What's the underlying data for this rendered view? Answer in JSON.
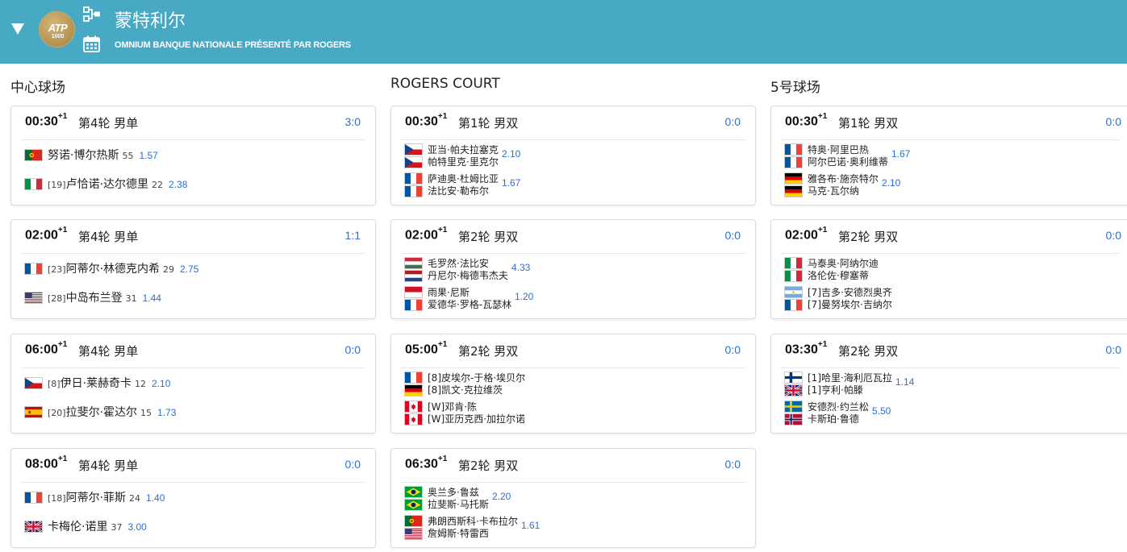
{
  "header": {
    "tournament_name": "蒙特利尔",
    "tournament_subtitle": "OMNIUM BANQUE NATIONALE PRÉSENTÉ PAR ROGERS",
    "logo_text": "ATP",
    "logo_sub": "1000",
    "bracket_icon": "bracket-icon",
    "calendar_icon": "calendar-icon",
    "collapse_icon": "triangle-down-icon",
    "bg_color": "#48a9c5"
  },
  "colors": {
    "accent": "#2a6fd6"
  },
  "courts": [
    {
      "title": "中心球场",
      "matches": [
        {
          "time": "00:30",
          "day": "+1",
          "round": "第4轮 男单",
          "score": "3:0",
          "p1": {
            "flag": "por",
            "seed": "",
            "name": "努诺·博尔热斯",
            "rank": "55",
            "odds": "1.57"
          },
          "p2": {
            "flag": "ita",
            "seed": "[19]",
            "name": "卢恰诺·达尔德里",
            "rank": "22",
            "odds": "2.38"
          }
        },
        {
          "time": "02:00",
          "day": "+1",
          "round": "第4轮 男单",
          "score": "1:1",
          "p1": {
            "flag": "fra",
            "seed": "[23]",
            "name": "阿蒂尔·林德克内希",
            "rank": "29",
            "odds": "2.75"
          },
          "p2": {
            "flag": "usa",
            "seed": "[28]",
            "name": "中岛布兰登",
            "rank": "31",
            "odds": "1.44"
          }
        },
        {
          "time": "06:00",
          "day": "+1",
          "round": "第4轮 男单",
          "score": "0:0",
          "p1": {
            "flag": "cze",
            "seed": "[8]",
            "name": "伊日·莱赫奇卡",
            "rank": "12",
            "odds": "2.10"
          },
          "p2": {
            "flag": "esp",
            "seed": "[20]",
            "name": "拉斐尔·霍达尔",
            "rank": "15",
            "odds": "1.73"
          }
        },
        {
          "time": "08:00",
          "day": "+1",
          "round": "第4轮 男单",
          "score": "0:0",
          "p1": {
            "flag": "fra",
            "seed": "[18]",
            "name": "阿蒂尔·菲斯",
            "rank": "24",
            "odds": "1.40"
          },
          "p2": {
            "flag": "gbr",
            "seed": "",
            "name": "卡梅伦·诺里",
            "rank": "37",
            "odds": "3.00"
          }
        }
      ]
    },
    {
      "title": "ROGERS COURT",
      "matches": [
        {
          "time": "00:30",
          "day": "+1",
          "round": "第1轮 男双",
          "score": "0:0",
          "t1": {
            "flags": [
              "cze",
              "cze"
            ],
            "names": [
              "亚当·帕夫拉塞克",
              "帕特里克·里克尔"
            ],
            "odds": "2.10"
          },
          "t2": {
            "flags": [
              "fra",
              "fra"
            ],
            "names": [
              "萨迪奥·杜姆比亚",
              "法比安·勒布尔"
            ],
            "odds": "1.67"
          }
        },
        {
          "time": "02:00",
          "day": "+1",
          "round": "第2轮 男双",
          "score": "0:0",
          "t1": {
            "flags": [
              "hun",
              "ned"
            ],
            "names": [
              "毛罗然·法比安",
              "丹尼尔·梅德韦杰夫"
            ],
            "odds": "4.33"
          },
          "t2": {
            "flags": [
              "mon",
              "fra"
            ],
            "names": [
              "雨果·尼斯",
              "爱德华·罗格-瓦瑟林"
            ],
            "odds": "1.20"
          }
        },
        {
          "time": "05:00",
          "day": "+1",
          "round": "第2轮 男双",
          "score": "0:0",
          "t1": {
            "flags": [
              "fra",
              "ger"
            ],
            "names": [
              "[8]皮埃尔-于格·埃贝尔",
              "[8]凯文·克拉维茨"
            ],
            "odds": ""
          },
          "t2": {
            "flags": [
              "can",
              "can"
            ],
            "names": [
              "[W]邓肯·陈",
              "[W]亚历克西·加拉尔诺"
            ],
            "odds": ""
          }
        },
        {
          "time": "06:30",
          "day": "+1",
          "round": "第2轮 男双",
          "score": "0:0",
          "t1": {
            "flags": [
              "bra",
              "bra"
            ],
            "names": [
              "奥兰多·鲁兹",
              "拉斐斯·马托斯"
            ],
            "odds": "2.20"
          },
          "t2": {
            "flags": [
              "por",
              "usa"
            ],
            "names": [
              "弗朗西斯科·卡布拉尔",
              "詹姆斯·特雷西"
            ],
            "odds": "1.61"
          }
        }
      ]
    },
    {
      "title": "5号球场",
      "matches": [
        {
          "time": "00:30",
          "day": "+1",
          "round": "第1轮 男双",
          "score": "0:0",
          "t1": {
            "flags": [
              "fra",
              "fra"
            ],
            "names": [
              "特奥·阿里巴热",
              "阿尔巴诺·奥利维蒂"
            ],
            "odds": "1.67"
          },
          "t2": {
            "flags": [
              "ger",
              "ger"
            ],
            "names": [
              "雅各布·施奈特尔",
              "马克·瓦尔纳"
            ],
            "odds": "2.10"
          }
        },
        {
          "time": "02:00",
          "day": "+1",
          "round": "第2轮 男双",
          "score": "0:0",
          "t1": {
            "flags": [
              "ita",
              "ita"
            ],
            "names": [
              "马泰奥·阿纳尔迪",
              "洛伦佐·穆塞蒂"
            ],
            "odds": ""
          },
          "t2": {
            "flags": [
              "arg",
              "fra"
            ],
            "names": [
              "[7]吉多·安德烈奥齐",
              "[7]曼努埃尔·吉纳尔"
            ],
            "odds": ""
          }
        },
        {
          "time": "03:30",
          "day": "+1",
          "round": "第2轮 男双",
          "score": "0:0",
          "t1": {
            "flags": [
              "fin",
              "gbr"
            ],
            "names": [
              "[1]哈里·海利厄瓦拉",
              "[1]亨利·帕滕"
            ],
            "odds": "1.14"
          },
          "t2": {
            "flags": [
              "swe",
              "nor"
            ],
            "names": [
              "安德烈·约兰松",
              "卡斯珀·鲁德"
            ],
            "odds": "5.50"
          }
        }
      ]
    }
  ]
}
